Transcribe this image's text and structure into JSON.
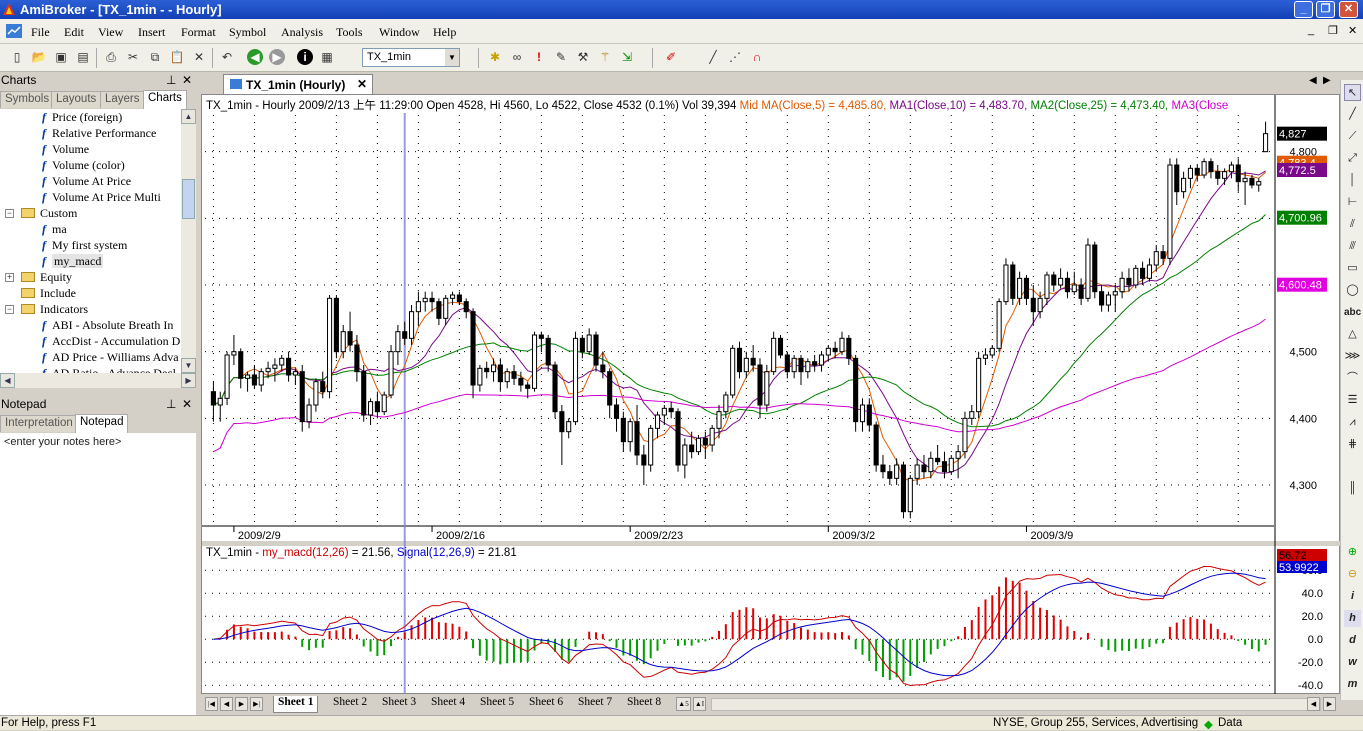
{
  "window": {
    "title": "AmiBroker - [TX_1min -  - Hourly]"
  },
  "menu": [
    "File",
    "Edit",
    "View",
    "Insert",
    "Format",
    "Symbol",
    "Analysis",
    "Tools",
    "Window",
    "Help"
  ],
  "toolbar": {
    "symbol": "TX_1min"
  },
  "charts_panel": {
    "title": "Charts",
    "tabs": [
      "Symbols",
      "Layouts",
      "Layers",
      "Charts"
    ],
    "tree": [
      {
        "label": "Price (foreign)",
        "type": "f",
        "indent": 1
      },
      {
        "label": "Relative Performance",
        "type": "f",
        "indent": 1
      },
      {
        "label": "Volume",
        "type": "f",
        "indent": 1
      },
      {
        "label": "Volume (color)",
        "type": "f",
        "indent": 1
      },
      {
        "label": "Volume At Price",
        "type": "f",
        "indent": 1
      },
      {
        "label": "Volume At Price Multi",
        "type": "f",
        "indent": 1
      },
      {
        "label": "Custom",
        "type": "folder",
        "indent": 0,
        "expand": "-"
      },
      {
        "label": "ma",
        "type": "f",
        "indent": 1
      },
      {
        "label": "My first system",
        "type": "f",
        "indent": 1
      },
      {
        "label": "my_macd",
        "type": "f",
        "indent": 1,
        "selected": true
      },
      {
        "label": "Equity",
        "type": "folder",
        "indent": 0,
        "expand": "+"
      },
      {
        "label": "Include",
        "type": "folder",
        "indent": 0,
        "expand": ""
      },
      {
        "label": "Indicators",
        "type": "folder",
        "indent": 0,
        "expand": "-"
      },
      {
        "label": "ABI - Absolute Breath In",
        "type": "f",
        "indent": 1
      },
      {
        "label": "AccDist - Accumulation D",
        "type": "f",
        "indent": 1
      },
      {
        "label": "AD Price - Williams Adva",
        "type": "f",
        "indent": 1
      },
      {
        "label": "AD Ratio - Advance Decl",
        "type": "f",
        "indent": 1
      }
    ]
  },
  "notepad": {
    "title": "Notepad",
    "tabs": [
      "Interpretation",
      "Notepad"
    ],
    "text": "<enter your notes here>"
  },
  "doc_tab": "TX_1min (Hourly)",
  "price_header": [
    {
      "text": "TX_1min - Hourly 2009/2/13 上午 11:29:00 Open 4528, Hi 4560, Lo 4522, Close 4532 (0.1%) Vol 39,394 ",
      "color": "#000000"
    },
    {
      "text": "Mid MA(Close,5) = 4,485.80, ",
      "color": "#e05a00"
    },
    {
      "text": "MA1(Close,10) = 4,483.70, ",
      "color": "#7a0a8a"
    },
    {
      "text": "MA2(Close,25) = 4,473.40, ",
      "color": "#008000"
    },
    {
      "text": "MA3(Close",
      "color": "#d000d0"
    }
  ],
  "macd_header": [
    {
      "text": "TX_1min - ",
      "color": "#000000"
    },
    {
      "text": "my_macd(12,26)",
      "color": "#cc0000"
    },
    {
      "text": " = 21.56, ",
      "color": "#000000"
    },
    {
      "text": "Signal(12,26,9)",
      "color": "#0000cc"
    },
    {
      "text": " = 21.81",
      "color": "#000000"
    }
  ],
  "price_axis": {
    "ticks": [
      "4,300",
      "4,400",
      "4,500",
      "4,600",
      "4,700",
      "4,800"
    ],
    "labels": [
      {
        "text": "4,827",
        "value": 4827,
        "bg": "#000000",
        "fg": "#ffffff"
      },
      {
        "text": "4,783.4",
        "value": 4783.4,
        "bg": "#e05a00",
        "fg": "#ffffff"
      },
      {
        "text": "4,772.5",
        "value": 4772.5,
        "bg": "#7a0a8a",
        "fg": "#ffffff"
      },
      {
        "text": "4,700.96",
        "value": 4700.96,
        "bg": "#008000",
        "fg": "#ffffff"
      },
      {
        "text": "4,600.48",
        "value": 4600.48,
        "bg": "#e000e0",
        "fg": "#ffffff"
      }
    ]
  },
  "date_axis": [
    "2009/2/9",
    "2009/2/16",
    "2009/2/23",
    "2009/3/2",
    "2009/3/9"
  ],
  "macd_axis": {
    "ticks": [
      "60.0",
      "40.0",
      "20.0",
      "0.0",
      "-20.0",
      "-40.0"
    ],
    "labels": [
      {
        "text": "56.72",
        "value": 56.72,
        "bg": "#cc0000",
        "fg": "#000000"
      },
      {
        "text": "53.9922",
        "value": 53.9922,
        "bg": "#0000cc",
        "fg": "#ffffff"
      }
    ]
  },
  "sheets": [
    "Sheet 1",
    "Sheet 2",
    "Sheet 3",
    "Sheet 4",
    "Sheet 5",
    "Sheet 6",
    "Sheet 7",
    "Sheet 8"
  ],
  "status": {
    "help": "For Help, press F1",
    "info": "NYSE, Group 255, Services, Advertising",
    "data": "Data"
  },
  "chart_data": {
    "type": "candlestick",
    "price_range": [
      4240,
      4855
    ],
    "ohlc": [
      [
        4440,
        4455,
        4395,
        4420
      ],
      [
        4420,
        4440,
        4395,
        4430
      ],
      [
        4430,
        4500,
        4420,
        4495
      ],
      [
        4495,
        4525,
        4480,
        4500
      ],
      [
        4500,
        4505,
        4445,
        4460
      ],
      [
        4460,
        4470,
        4440,
        4465
      ],
      [
        4465,
        4480,
        4445,
        4450
      ],
      [
        4450,
        4475,
        4440,
        4470
      ],
      [
        4470,
        4485,
        4460,
        4475
      ],
      [
        4475,
        4490,
        4455,
        4480
      ],
      [
        4480,
        4495,
        4470,
        4490
      ],
      [
        4490,
        4500,
        4455,
        4465
      ],
      [
        4465,
        4475,
        4450,
        4470
      ],
      [
        4470,
        4480,
        4380,
        4395
      ],
      [
        4395,
        4430,
        4385,
        4420
      ],
      [
        4420,
        4460,
        4410,
        4455
      ],
      [
        4455,
        4470,
        4430,
        4440
      ],
      [
        4440,
        4585,
        4430,
        4580
      ],
      [
        4580,
        4585,
        4490,
        4500
      ],
      [
        4500,
        4540,
        4490,
        4530
      ],
      [
        4530,
        4560,
        4500,
        4510
      ],
      [
        4510,
        4525,
        4455,
        4470
      ],
      [
        4470,
        4480,
        4395,
        4405
      ],
      [
        4405,
        4430,
        4390,
        4425
      ],
      [
        4425,
        4440,
        4400,
        4410
      ],
      [
        4410,
        4440,
        4405,
        4435
      ],
      [
        4435,
        4510,
        4430,
        4500
      ],
      [
        4500,
        4540,
        4480,
        4530
      ],
      [
        4530,
        4545,
        4510,
        4520
      ],
      [
        4520,
        4570,
        4510,
        4560
      ],
      [
        4560,
        4590,
        4540,
        4575
      ],
      [
        4575,
        4590,
        4560,
        4580
      ],
      [
        4580,
        4590,
        4560,
        4575
      ],
      [
        4575,
        4580,
        4540,
        4550
      ],
      [
        4550,
        4585,
        4540,
        4580
      ],
      [
        4580,
        4590,
        4570,
        4585
      ],
      [
        4585,
        4590,
        4570,
        4575
      ],
      [
        4575,
        4580,
        4550,
        4560
      ],
      [
        4560,
        4565,
        4430,
        4450
      ],
      [
        4450,
        4480,
        4440,
        4475
      ],
      [
        4475,
        4485,
        4460,
        4470
      ],
      [
        4470,
        4490,
        4455,
        4480
      ],
      [
        4480,
        4490,
        4440,
        4455
      ],
      [
        4455,
        4475,
        4445,
        4470
      ],
      [
        4470,
        4480,
        4450,
        4460
      ],
      [
        4460,
        4470,
        4440,
        4450
      ],
      [
        4450,
        4455,
        4430,
        4445
      ],
      [
        4445,
        4530,
        4440,
        4525
      ],
      [
        4525,
        4530,
        4500,
        4520
      ],
      [
        4520,
        4525,
        4470,
        4480
      ],
      [
        4480,
        4485,
        4400,
        4410
      ],
      [
        4410,
        4420,
        4330,
        4380
      ],
      [
        4380,
        4400,
        4370,
        4395
      ],
      [
        4395,
        4530,
        4390,
        4520
      ],
      [
        4520,
        4525,
        4490,
        4500
      ],
      [
        4500,
        4535,
        4495,
        4525
      ],
      [
        4525,
        4530,
        4470,
        4480
      ],
      [
        4480,
        4500,
        4460,
        4470
      ],
      [
        4470,
        4475,
        4400,
        4420
      ],
      [
        4420,
        4430,
        4380,
        4400
      ],
      [
        4400,
        4410,
        4350,
        4365
      ],
      [
        4365,
        4400,
        4350,
        4395
      ],
      [
        4395,
        4420,
        4330,
        4345
      ],
      [
        4345,
        4360,
        4300,
        4330
      ],
      [
        4330,
        4390,
        4320,
        4385
      ],
      [
        4385,
        4410,
        4370,
        4405
      ],
      [
        4405,
        4420,
        4390,
        4415
      ],
      [
        4415,
        4425,
        4400,
        4410
      ],
      [
        4410,
        4415,
        4320,
        4330
      ],
      [
        4330,
        4370,
        4310,
        4360
      ],
      [
        4360,
        4380,
        4340,
        4350
      ],
      [
        4350,
        4375,
        4345,
        4370
      ],
      [
        4370,
        4380,
        4340,
        4360
      ],
      [
        4360,
        4390,
        4350,
        4385
      ],
      [
        4385,
        4420,
        4370,
        4410
      ],
      [
        4410,
        4440,
        4400,
        4435
      ],
      [
        4435,
        4510,
        4430,
        4505
      ],
      [
        4505,
        4515,
        4460,
        4470
      ],
      [
        4470,
        4500,
        4460,
        4490
      ],
      [
        4490,
        4510,
        4470,
        4480
      ],
      [
        4480,
        4490,
        4400,
        4420
      ],
      [
        4420,
        4480,
        4410,
        4470
      ],
      [
        4470,
        4530,
        4465,
        4520
      ],
      [
        4520,
        4525,
        4490,
        4495
      ],
      [
        4495,
        4500,
        4460,
        4470
      ],
      [
        4470,
        4495,
        4460,
        4490
      ],
      [
        4490,
        4495,
        4450,
        4470
      ],
      [
        4470,
        4490,
        4460,
        4485
      ],
      [
        4485,
        4495,
        4470,
        4480
      ],
      [
        4480,
        4500,
        4470,
        4495
      ],
      [
        4495,
        4510,
        4485,
        4505
      ],
      [
        4505,
        4515,
        4490,
        4500
      ],
      [
        4500,
        4530,
        4495,
        4520
      ],
      [
        4520,
        4525,
        4480,
        4490
      ],
      [
        4490,
        4495,
        4380,
        4395
      ],
      [
        4395,
        4430,
        4380,
        4420
      ],
      [
        4420,
        4430,
        4380,
        4390
      ],
      [
        4390,
        4395,
        4320,
        4330
      ],
      [
        4330,
        4345,
        4310,
        4320
      ],
      [
        4320,
        4330,
        4300,
        4310
      ],
      [
        4310,
        4340,
        4300,
        4330
      ],
      [
        4330,
        4335,
        4250,
        4260
      ],
      [
        4260,
        4315,
        4250,
        4310
      ],
      [
        4310,
        4340,
        4300,
        4330
      ],
      [
        4330,
        4345,
        4310,
        4320
      ],
      [
        4320,
        4350,
        4310,
        4340
      ],
      [
        4340,
        4360,
        4330,
        4335
      ],
      [
        4335,
        4350,
        4310,
        4320
      ],
      [
        4320,
        4345,
        4315,
        4340
      ],
      [
        4340,
        4360,
        4310,
        4350
      ],
      [
        4350,
        4410,
        4340,
        4400
      ],
      [
        4400,
        4420,
        4390,
        4410
      ],
      [
        4410,
        4500,
        4400,
        4490
      ],
      [
        4490,
        4505,
        4480,
        4495
      ],
      [
        4495,
        4510,
        4490,
        4505
      ],
      [
        4505,
        4580,
        4500,
        4575
      ],
      [
        4575,
        4640,
        4570,
        4630
      ],
      [
        4630,
        4635,
        4570,
        4580
      ],
      [
        4580,
        4620,
        4570,
        4610
      ],
      [
        4610,
        4615,
        4570,
        4580
      ],
      [
        4580,
        4600,
        4540,
        4560
      ],
      [
        4560,
        4590,
        4550,
        4580
      ],
      [
        4580,
        4620,
        4570,
        4615
      ],
      [
        4615,
        4620,
        4590,
        4600
      ],
      [
        4600,
        4625,
        4595,
        4610
      ],
      [
        4610,
        4620,
        4580,
        4590
      ],
      [
        4590,
        4620,
        4585,
        4600
      ],
      [
        4600,
        4610,
        4570,
        4580
      ],
      [
        4580,
        4670,
        4575,
        4660
      ],
      [
        4660,
        4665,
        4580,
        4590
      ],
      [
        4590,
        4600,
        4560,
        4570
      ],
      [
        4570,
        4590,
        4560,
        4585
      ],
      [
        4585,
        4600,
        4560,
        4590
      ],
      [
        4590,
        4620,
        4580,
        4610
      ],
      [
        4610,
        4625,
        4590,
        4600
      ],
      [
        4600,
        4630,
        4595,
        4625
      ],
      [
        4625,
        4635,
        4600,
        4610
      ],
      [
        4610,
        4640,
        4605,
        4630
      ],
      [
        4630,
        4660,
        4620,
        4650
      ],
      [
        4650,
        4660,
        4630,
        4640
      ],
      [
        4640,
        4790,
        4630,
        4780
      ],
      [
        4780,
        4790,
        4720,
        4740
      ],
      [
        4740,
        4770,
        4730,
        4760
      ],
      [
        4760,
        4780,
        4745,
        4775
      ],
      [
        4775,
        4780,
        4755,
        4765
      ],
      [
        4765,
        4790,
        4760,
        4785
      ],
      [
        4785,
        4790,
        4760,
        4770
      ],
      [
        4770,
        4780,
        4750,
        4760
      ],
      [
        4760,
        4775,
        4750,
        4770
      ],
      [
        4770,
        4785,
        4760,
        4780
      ],
      [
        4780,
        4790,
        4740,
        4755
      ],
      [
        4755,
        4770,
        4720,
        4760
      ],
      [
        4760,
        4765,
        4745,
        4750
      ],
      [
        4750,
        4760,
        4740,
        4755
      ],
      [
        4800,
        4845,
        4800,
        4827
      ]
    ],
    "ma_series": [
      {
        "name": "Mid MA(Close,5)",
        "color": "#e05a00",
        "period": 5
      },
      {
        "name": "MA1(Close,10)",
        "color": "#7a0a8a",
        "period": 10
      },
      {
        "name": "MA2(Close,25)",
        "color": "#008000",
        "period": 25
      },
      {
        "name": "MA3",
        "color": "#d000d0",
        "period": 60
      }
    ],
    "macd": {
      "line": "my_macd(12,26)",
      "signal": "Signal(12,26,9)",
      "range": [
        -45,
        68
      ],
      "line_color": "#cc0000",
      "signal_color": "#0000cc"
    }
  }
}
